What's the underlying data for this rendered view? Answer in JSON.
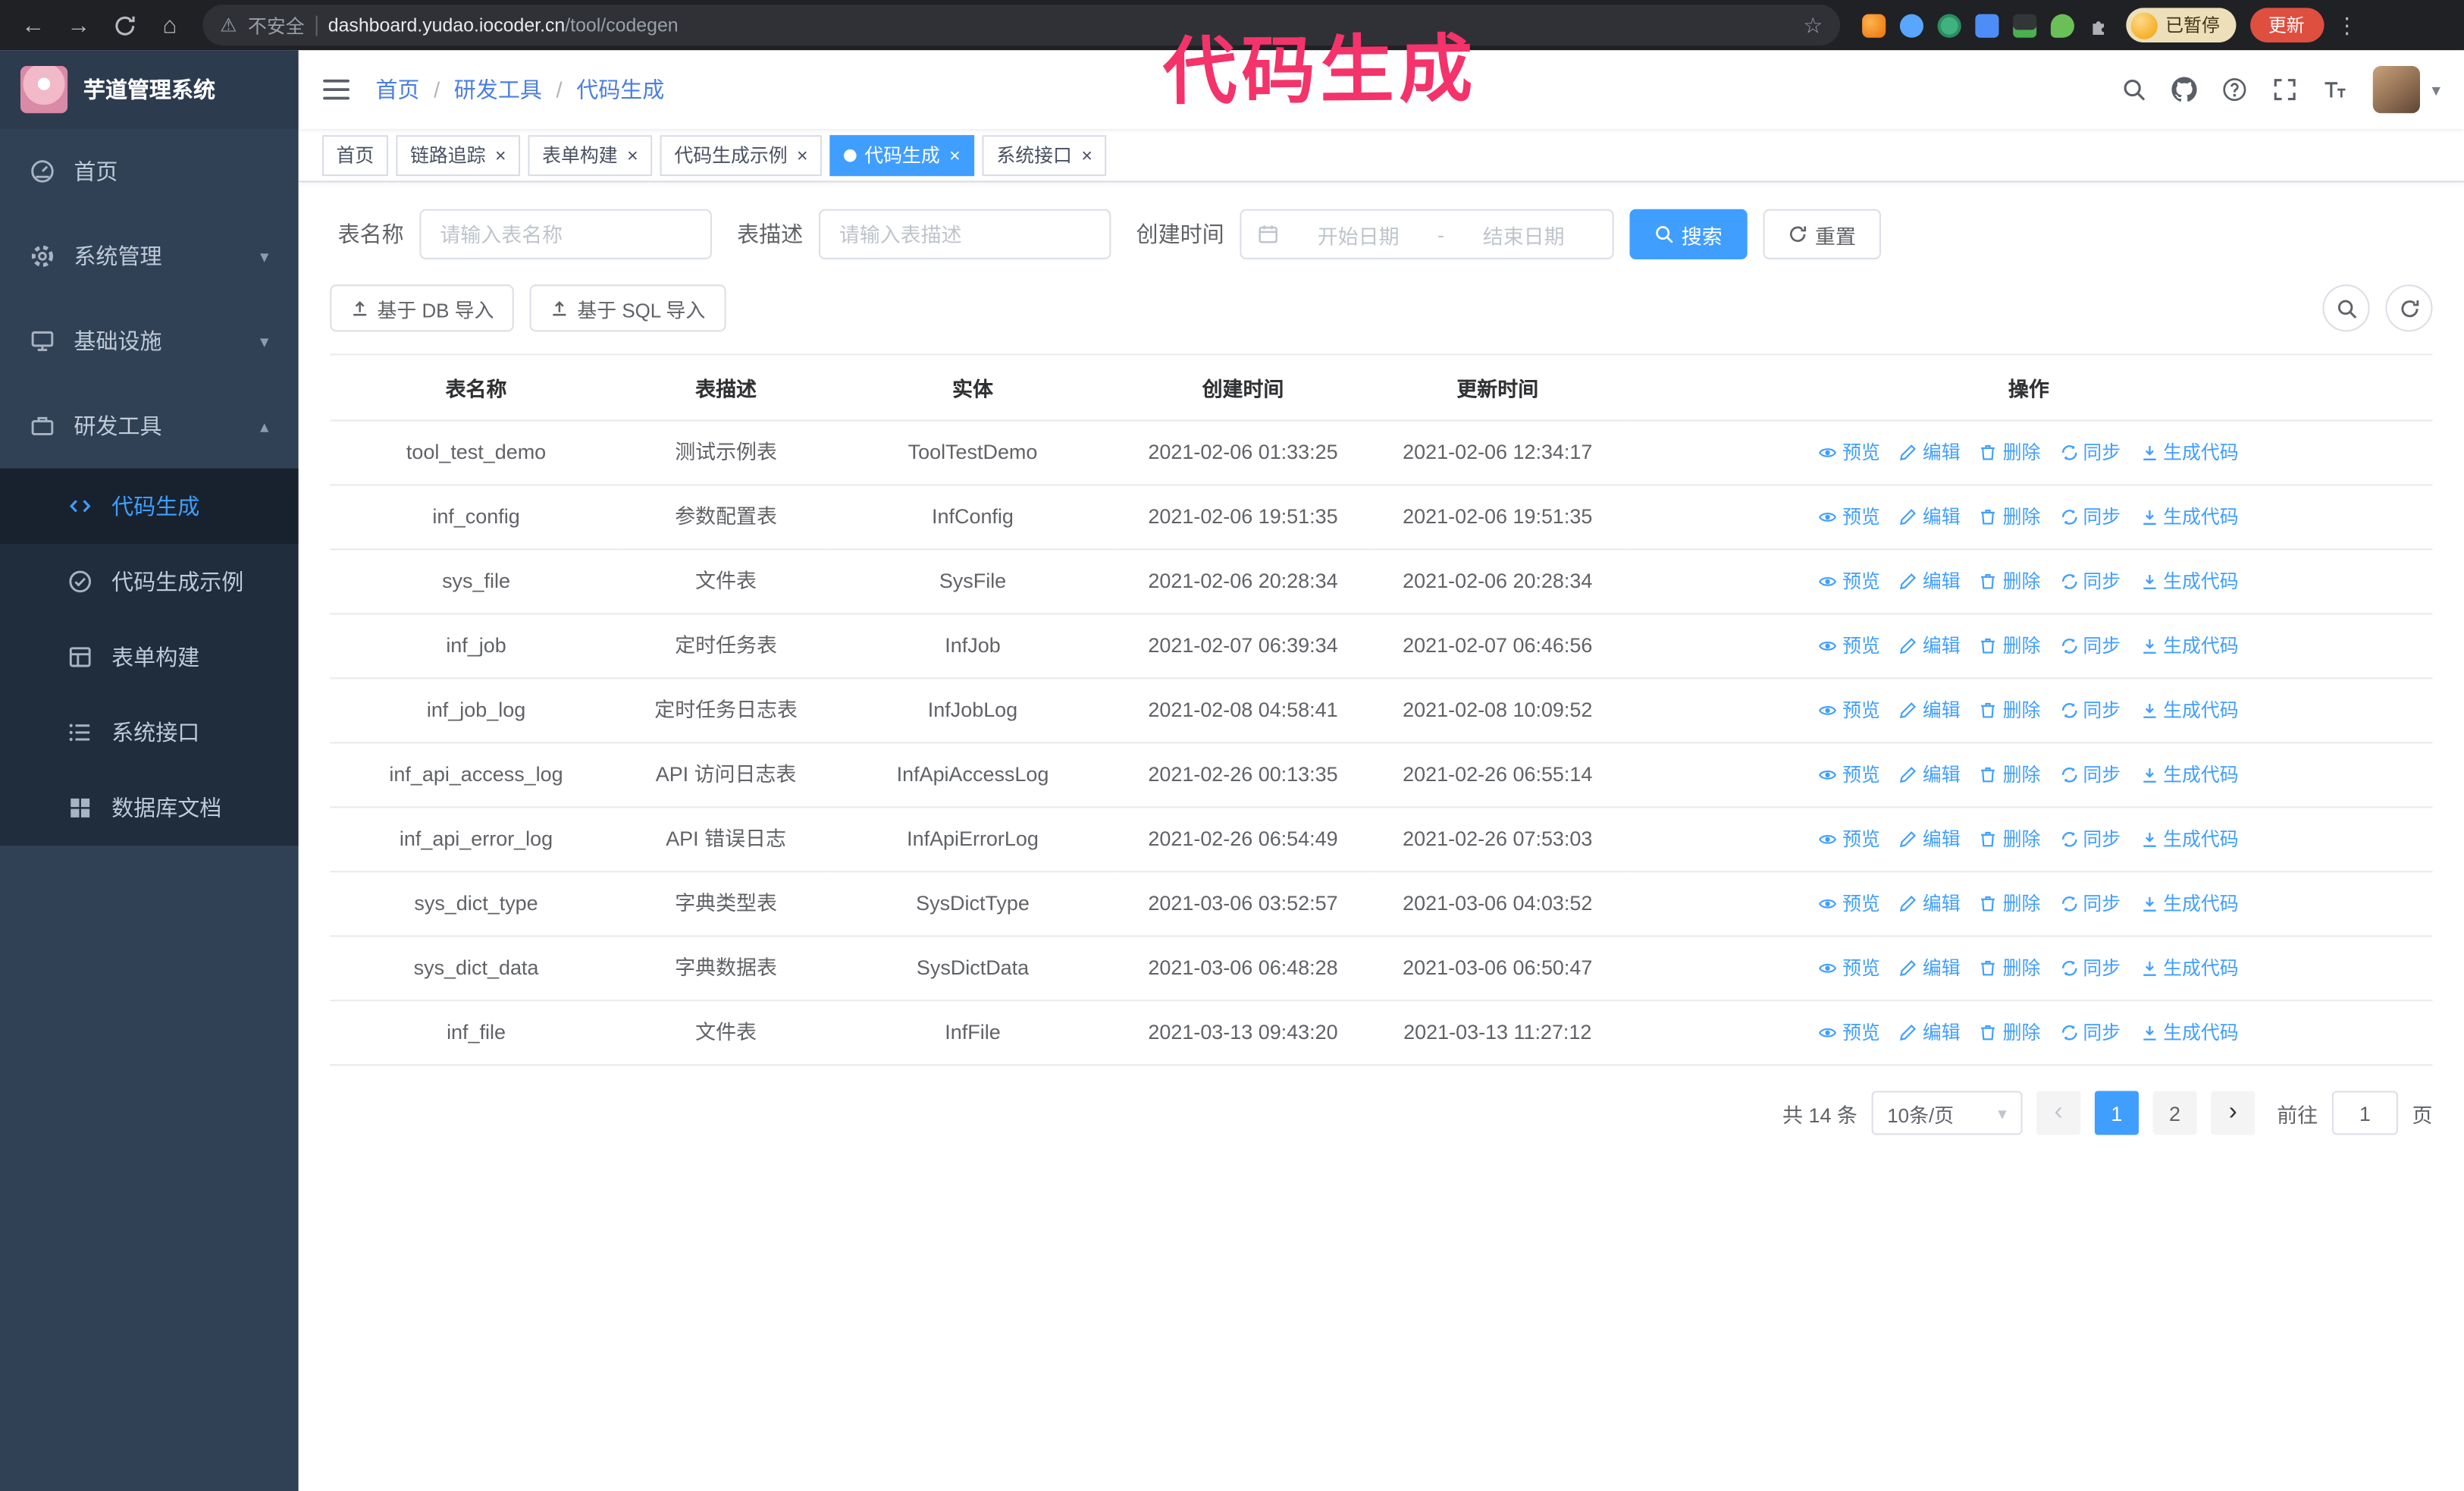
{
  "annotation": {
    "text": "代码生成"
  },
  "colors": {
    "accent": "#409eff",
    "sidebar_bg": "#304156",
    "submenu_bg": "#1f2d3d",
    "annotation": "#f4336b",
    "chrome_bg": "#202124",
    "update_button": "#de4f3f"
  },
  "icons": {
    "back": "←",
    "forward": "→",
    "home": "⌂",
    "star": "☆",
    "warning": "⚠",
    "menu_dots": "⋮",
    "caret_down": "▾",
    "chevron_down": "▾",
    "chevron_up": "▴",
    "close": "×",
    "breadcrumb_separator": "/",
    "prev": "‹",
    "next": "›"
  },
  "browser": {
    "security_label": "不安全",
    "url_host": "dashboard.yudao.iocoder.cn",
    "url_path": "/tool/codegen",
    "paused_badge": "已暂停",
    "update_button": "更新"
  },
  "sidebar": {
    "logo_title": "芋道管理系统",
    "items": [
      {
        "label": "首页"
      },
      {
        "label": "系统管理"
      },
      {
        "label": "基础设施"
      },
      {
        "label": "研发工具"
      }
    ],
    "submenu": [
      {
        "label": "代码生成",
        "active": true
      },
      {
        "label": "代码生成示例"
      },
      {
        "label": "表单构建"
      },
      {
        "label": "系统接口"
      },
      {
        "label": "数据库文档"
      }
    ]
  },
  "header": {
    "breadcrumb": [
      "首页",
      "研发工具",
      "代码生成"
    ]
  },
  "tabs": [
    {
      "label": "首页",
      "closable": false,
      "active": false
    },
    {
      "label": "链路追踪",
      "closable": true,
      "active": false
    },
    {
      "label": "表单构建",
      "closable": true,
      "active": false
    },
    {
      "label": "代码生成示例",
      "closable": true,
      "active": false
    },
    {
      "label": "代码生成",
      "closable": true,
      "active": true
    },
    {
      "label": "系统接口",
      "closable": true,
      "active": false
    }
  ],
  "filters": {
    "table_name_label": "表名称",
    "table_name_placeholder": "请输入表名称",
    "table_desc_label": "表描述",
    "table_desc_placeholder": "请输入表描述",
    "create_time_label": "创建时间",
    "date_start_placeholder": "开始日期",
    "date_separator": "-",
    "date_end_placeholder": "结束日期",
    "search_button": "搜索",
    "reset_button": "重置"
  },
  "toolbar": {
    "import_db_button": "基于 DB 导入",
    "import_sql_button": "基于 SQL 导入"
  },
  "table": {
    "columns": [
      "表名称",
      "表描述",
      "实体",
      "创建时间",
      "更新时间",
      "操作"
    ],
    "actions": [
      "预览",
      "编辑",
      "删除",
      "同步",
      "生成代码"
    ],
    "rows": [
      {
        "name": "tool_test_demo",
        "desc": "测试示例表",
        "entity": "ToolTestDemo",
        "created": "2021-02-06 01:33:25",
        "updated": "2021-02-06 12:34:17"
      },
      {
        "name": "inf_config",
        "desc": "参数配置表",
        "entity": "InfConfig",
        "created": "2021-02-06 19:51:35",
        "updated": "2021-02-06 19:51:35"
      },
      {
        "name": "sys_file",
        "desc": "文件表",
        "entity": "SysFile",
        "created": "2021-02-06 20:28:34",
        "updated": "2021-02-06 20:28:34"
      },
      {
        "name": "inf_job",
        "desc": "定时任务表",
        "entity": "InfJob",
        "created": "2021-02-07 06:39:34",
        "updated": "2021-02-07 06:46:56"
      },
      {
        "name": "inf_job_log",
        "desc": "定时任务日志表",
        "entity": "InfJobLog",
        "created": "2021-02-08 04:58:41",
        "updated": "2021-02-08 10:09:52"
      },
      {
        "name": "inf_api_access_log",
        "desc": "API 访问日志表",
        "entity": "InfApiAccessLog",
        "created": "2021-02-26 00:13:35",
        "updated": "2021-02-26 06:55:14"
      },
      {
        "name": "inf_api_error_log",
        "desc": "API 错误日志",
        "entity": "InfApiErrorLog",
        "created": "2021-02-26 06:54:49",
        "updated": "2021-02-26 07:53:03"
      },
      {
        "name": "sys_dict_type",
        "desc": "字典类型表",
        "entity": "SysDictType",
        "created": "2021-03-06 03:52:57",
        "updated": "2021-03-06 04:03:52"
      },
      {
        "name": "sys_dict_data",
        "desc": "字典数据表",
        "entity": "SysDictData",
        "created": "2021-03-06 06:48:28",
        "updated": "2021-03-06 06:50:47"
      },
      {
        "name": "inf_file",
        "desc": "文件表",
        "entity": "InfFile",
        "created": "2021-03-13 09:43:20",
        "updated": "2021-03-13 11:27:12"
      }
    ]
  },
  "pagination": {
    "total": "共 14 条",
    "page_size": "10条/页",
    "pages": [
      "1",
      "2"
    ],
    "active_page": "1",
    "goto_label": "前往",
    "goto_value": "1",
    "goto_suffix": "页"
  }
}
